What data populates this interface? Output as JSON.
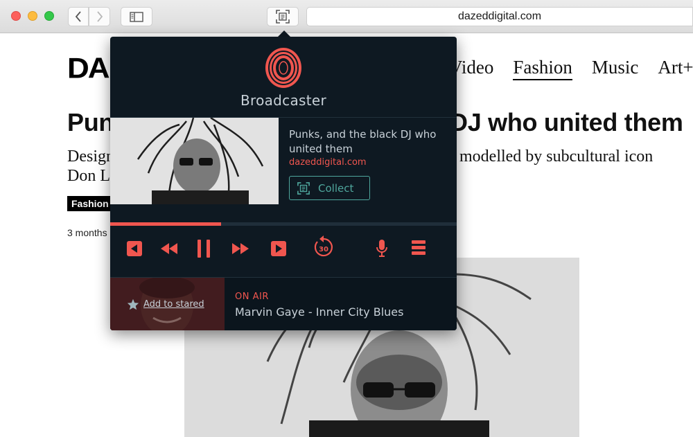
{
  "browser": {
    "url": "dazeddigital.com"
  },
  "site": {
    "logo_text": "DA",
    "nav": [
      {
        "label": "Video"
      },
      {
        "label": "Fashion"
      },
      {
        "label": "Music"
      },
      {
        "label": "Art+Cu"
      }
    ],
    "headline_left": "Pun",
    "headline_right": "DJ who united them",
    "subtitle_line1_left": "Design",
    "subtitle_line1_right": "modelled by subcultural icon",
    "subtitle_line2": "Don Le",
    "tag": "Fashion",
    "date": "3 months"
  },
  "broadcaster": {
    "brand": "Broadcaster",
    "logo_letter": "O",
    "article": {
      "title": "Punks, and the black DJ who united them",
      "source": "dazeddigital.com",
      "collect_label": "Collect"
    },
    "progress": 0.32,
    "controls": [
      {
        "name": "previous-track",
        "icon": "skip-back-icon"
      },
      {
        "name": "rewind",
        "icon": "rewind-icon"
      },
      {
        "name": "pause",
        "icon": "pause-icon"
      },
      {
        "name": "fast-forward",
        "icon": "fast-forward-icon"
      },
      {
        "name": "next-track",
        "icon": "skip-forward-icon"
      },
      {
        "name": "replay-30",
        "icon": "replay-30-icon",
        "label": "30"
      },
      {
        "name": "microphone",
        "icon": "microphone-icon"
      },
      {
        "name": "playlist",
        "icon": "list-icon"
      }
    ],
    "now_playing": {
      "star_label": "Add to stared",
      "status": "ON AIR",
      "track": "Marvin Gaye - Inner City Blues"
    }
  },
  "colors": {
    "accent": "#f0564f",
    "teal": "#4fa79d",
    "panel": "#0e1922"
  }
}
